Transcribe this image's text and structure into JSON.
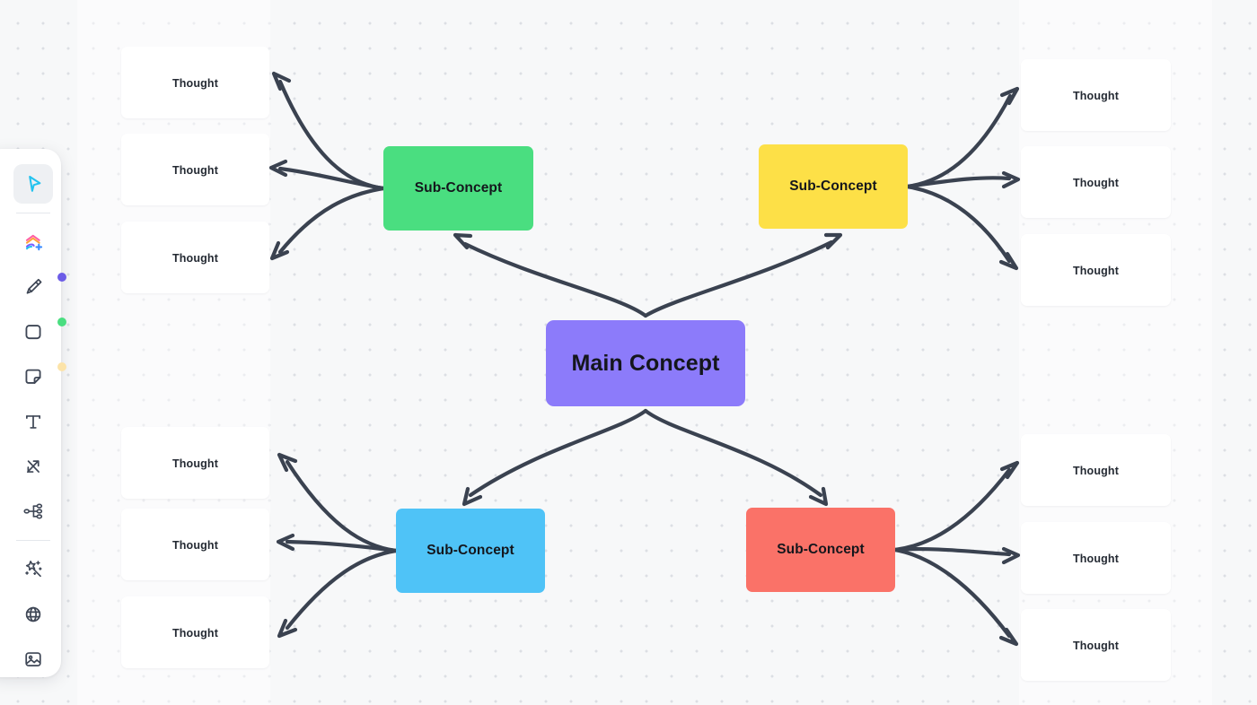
{
  "app": {
    "canvas_bg": "#f7f8f9",
    "dot_color": "#dcdfe4",
    "connector_color": "#3a4250"
  },
  "mindmap": {
    "root": {
      "label": "Main Concept",
      "color": "#8c7bfa"
    },
    "branches": [
      {
        "label": "Sub-Concept",
        "color": "#4ade80",
        "position": "top-left",
        "children": [
          {
            "label": "Thought"
          },
          {
            "label": "Thought"
          },
          {
            "label": "Thought"
          }
        ]
      },
      {
        "label": "Sub-Concept",
        "color": "#fde047",
        "position": "top-right",
        "children": [
          {
            "label": "Thought"
          },
          {
            "label": "Thought"
          },
          {
            "label": "Thought"
          }
        ]
      },
      {
        "label": "Sub-Concept",
        "color": "#4fc3f7",
        "position": "bottom-left",
        "children": [
          {
            "label": "Thought"
          },
          {
            "label": "Thought"
          },
          {
            "label": "Thought"
          }
        ]
      },
      {
        "label": "Sub-Concept",
        "color": "#fa7268",
        "position": "bottom-right",
        "children": [
          {
            "label": "Thought"
          },
          {
            "label": "Thought"
          },
          {
            "label": "Thought"
          }
        ]
      }
    ]
  },
  "toolbar": {
    "tools": [
      {
        "name": "select-cursor",
        "label": "Select",
        "active": true
      },
      {
        "name": "shapes-stack-add",
        "label": "Add shapes"
      },
      {
        "name": "highlighter-pen",
        "label": "Pen"
      },
      {
        "name": "rectangle",
        "label": "Shape"
      },
      {
        "name": "sticky-note",
        "label": "Sticky note"
      },
      {
        "name": "text",
        "label": "Text"
      },
      {
        "name": "connector-arrow",
        "label": "Connector"
      },
      {
        "name": "mindmap-node",
        "label": "Mind map"
      },
      {
        "name": "magic-wand",
        "label": "AI"
      },
      {
        "name": "globe",
        "label": "Embed"
      },
      {
        "name": "image",
        "label": "Image"
      }
    ],
    "color_swatches": [
      {
        "name": "purple",
        "hex": "#6c5ce7"
      },
      {
        "name": "green",
        "hex": "#4ade80"
      },
      {
        "name": "yellow",
        "hex": "#fce3a8"
      }
    ]
  }
}
